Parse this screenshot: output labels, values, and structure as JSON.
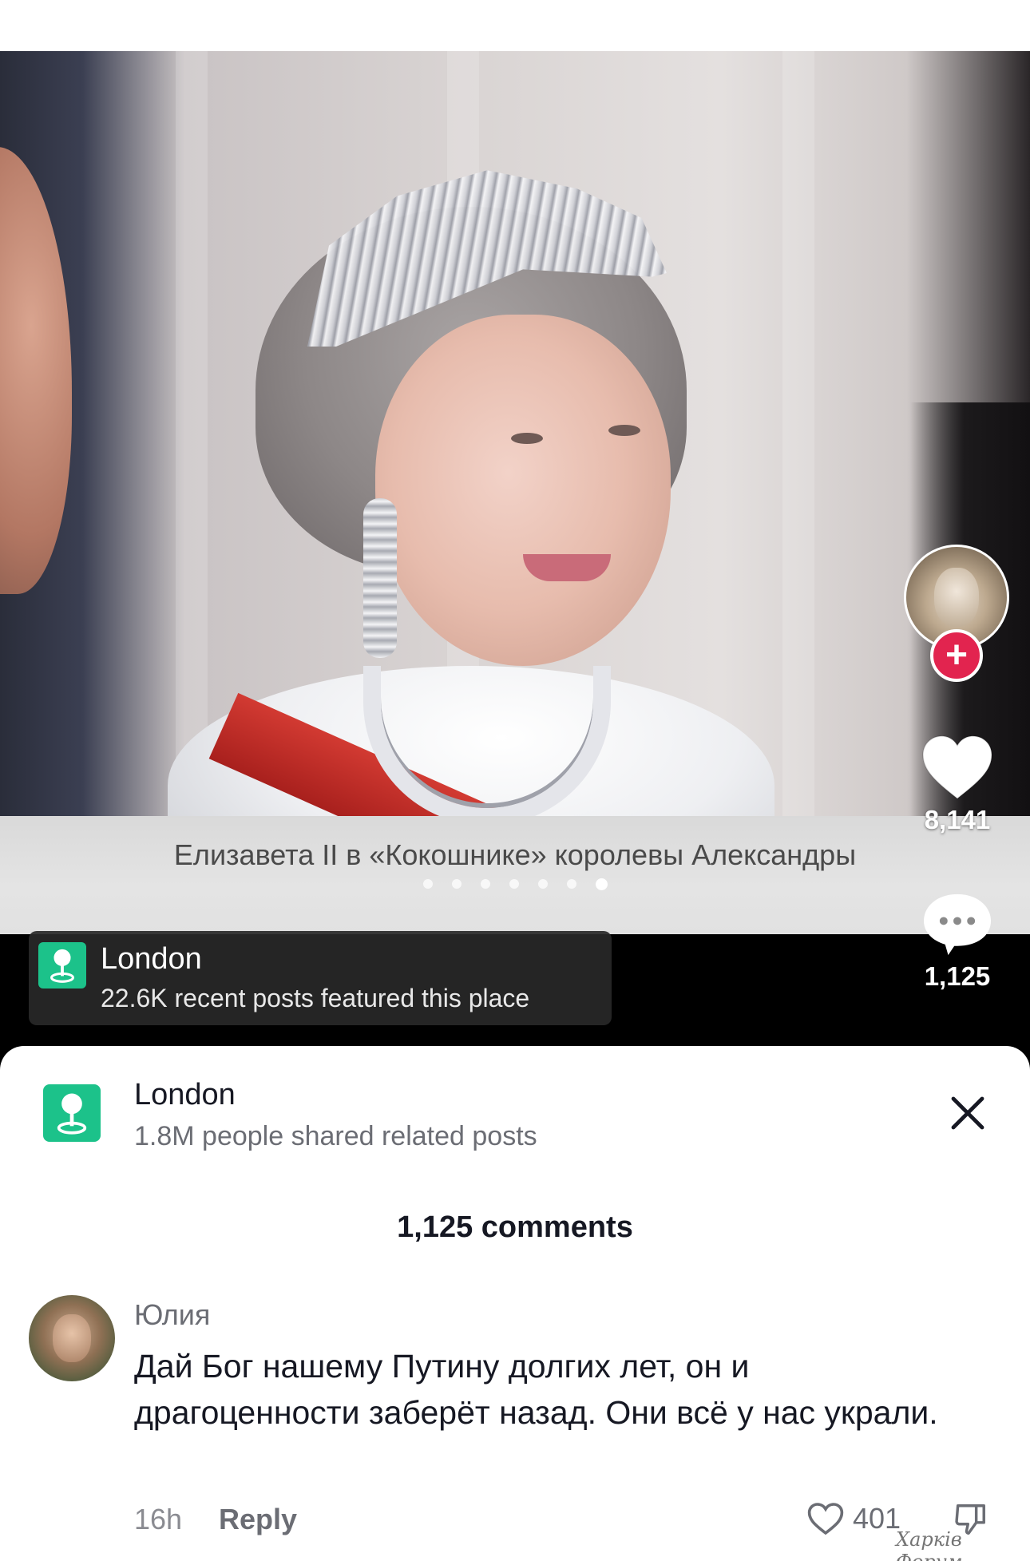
{
  "post": {
    "caption": "Елизавета II в «Кокошнике» королевы Александры",
    "slide_count": 7,
    "active_slide": 7
  },
  "actions": {
    "likes": "8,141",
    "comments": "1,125",
    "follow_icon": "plus-icon"
  },
  "location_pill": {
    "title": "London",
    "subtitle": "22.6K recent posts featured this place"
  },
  "sheet": {
    "location_title": "London",
    "location_subtitle": "1.8M people shared related posts",
    "comments_count": "1,125 comments"
  },
  "comment": {
    "username": "Юлия",
    "text": "Дай Бог нашему Путину долгих лет, он и драгоценности заберёт назад. Они всё у нас украли.",
    "time": "16h",
    "reply_label": "Reply",
    "likes": "401"
  },
  "watermark": "Харків Форум",
  "colors": {
    "accent_red": "#e2244f",
    "location_green": "#1cc28a"
  }
}
